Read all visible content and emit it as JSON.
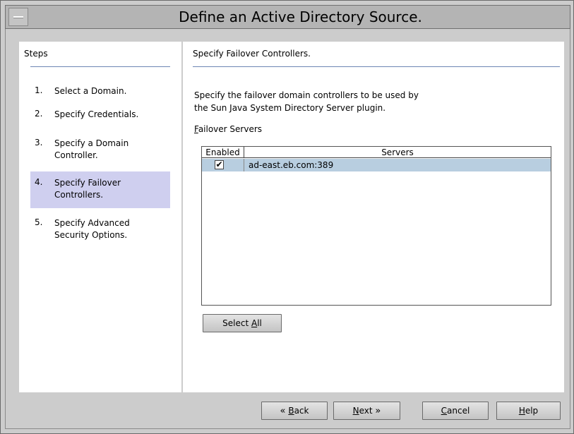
{
  "window": {
    "title": "Define an Active Directory Source."
  },
  "steps": {
    "heading": "Steps",
    "items": [
      {
        "num": "1.",
        "label": "Select a Domain."
      },
      {
        "num": "2.",
        "label": "Specify Credentials."
      },
      {
        "num": "3.",
        "label": "Specify a Domain Controller."
      },
      {
        "num": "4.",
        "label": "Specify Failover Controllers."
      },
      {
        "num": "5.",
        "label": "Specify Advanced Security Options."
      }
    ],
    "active_index": 3
  },
  "main": {
    "section_title": "Specify Failover Controllers.",
    "description_line1": "Specify the failover domain controllers to be used by",
    "description_line2": "the Sun Java System Directory Server plugin.",
    "table_label_mnemonic": "F",
    "table_label_rest": "ailover Servers",
    "table": {
      "headers": [
        "Enabled",
        "Servers"
      ],
      "rows": [
        {
          "enabled": true,
          "server": "ad-east.eb.com:389"
        }
      ]
    },
    "select_all": {
      "prefix": "Select ",
      "mnemonic": "A",
      "suffix": "ll"
    }
  },
  "footer": {
    "back": {
      "mnemonic": "B",
      "rest": "ack"
    },
    "next": {
      "mnemonic": "N",
      "rest": "ext"
    },
    "cancel": {
      "mnemonic": "C",
      "rest": "ancel"
    },
    "help": {
      "mnemonic": "H",
      "rest": "elp"
    }
  },
  "icons": {
    "menu": "window-menu-icon",
    "back": "chevron-left-icon",
    "next": "chevron-right-icon",
    "check": "checkmark-icon"
  },
  "colors": {
    "selection": "#b8cee0",
    "active_step": "#cfcfef",
    "separator": "#6d86b3",
    "window_bg": "#cccccc"
  }
}
